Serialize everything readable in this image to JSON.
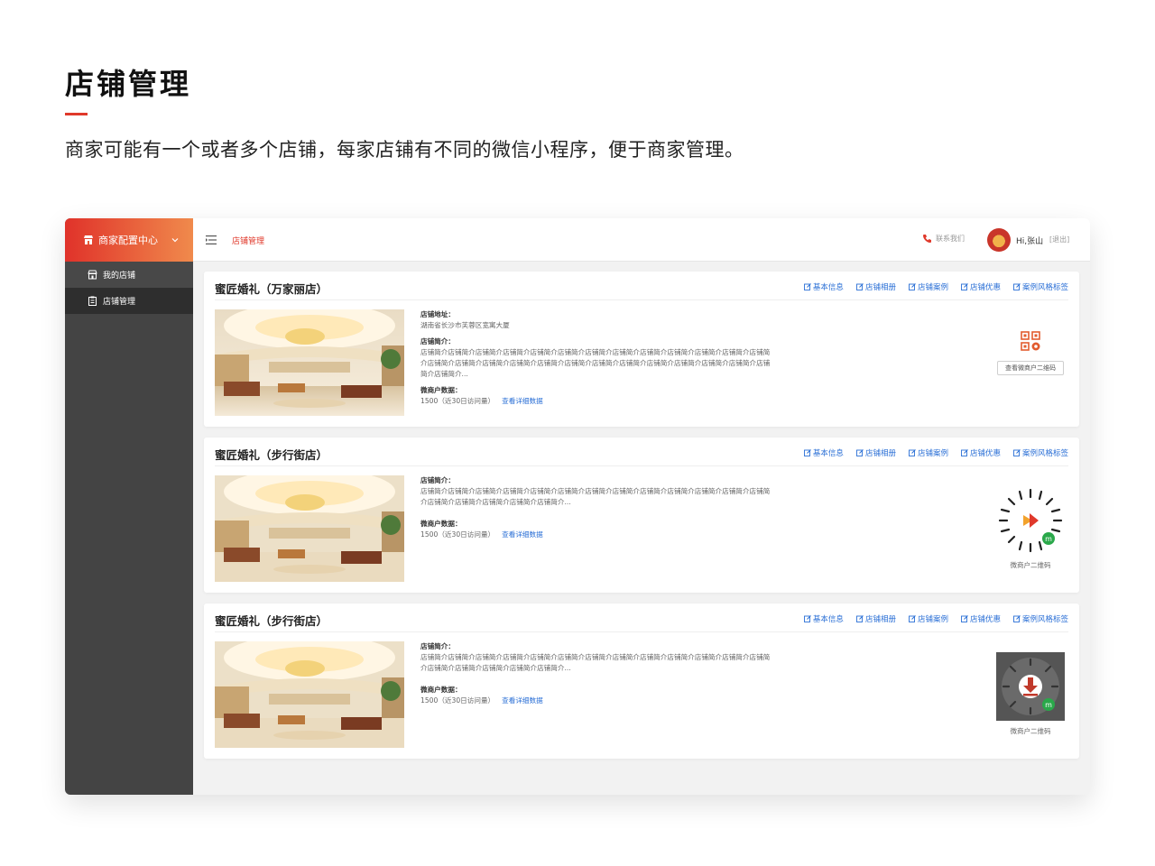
{
  "header": {
    "title": "店铺管理",
    "subtitle": "商家可能有一个或者多个店铺，每家店铺有不同的微信小程序，便于商家管理。"
  },
  "sidebar": {
    "brand": "商家配置中心",
    "items": [
      {
        "label": "我的店铺",
        "icon": "store-icon"
      },
      {
        "label": "店铺管理",
        "icon": "clipboard-icon"
      }
    ]
  },
  "topbar": {
    "breadcrumb": "店铺管理",
    "contact": "联系我们",
    "user": "Hi,张山",
    "logout": "[退出]"
  },
  "actions": [
    "基本信息",
    "店铺相册",
    "店铺案例",
    "店铺优惠",
    "案例风格标签"
  ],
  "labels": {
    "address": "店铺地址：",
    "intro": "店铺简介：",
    "stats": "微商户数据：",
    "visits": "1500（近30日访问量）",
    "detail_link": "查看详细数据",
    "qr_button": "查看微商户二维码",
    "qr_caption": "微商户二维码"
  },
  "stores": [
    {
      "name": "蜜匠婚礼（万家丽店）",
      "address": "湖南省长沙市芙蓉区宽寓大厦",
      "intro": "店铺简介店铺简介店铺简介店铺简介店铺简介店铺简介店铺简介店铺简介店铺简介店铺简介店铺简介店铺简介店铺简介店铺简介店铺简介店铺简介店铺简介店铺简介店铺简介店铺简介店铺简介店铺简介店铺简介店铺简介店铺简介店铺简介店铺简介..."
    },
    {
      "name": "蜜匠婚礼（步行街店）",
      "intro": "店铺简介店铺简介店铺简介店铺简介店铺简介店铺简介店铺简介店铺简介店铺简介店铺简介店铺简介店铺简介店铺简介店铺简介店铺简介店铺简介店铺简介店铺简介..."
    },
    {
      "name": "蜜匠婚礼（步行街店）",
      "intro": "店铺简介店铺简介店铺简介店铺简介店铺简介店铺简介店铺简介店铺简介店铺简介店铺简介店铺简介店铺简介店铺简介店铺简介店铺简介店铺简介店铺简介店铺简介..."
    }
  ],
  "colors": {
    "accent": "#e0392b",
    "link": "#2a6fd6",
    "sidebar": "#444444"
  }
}
